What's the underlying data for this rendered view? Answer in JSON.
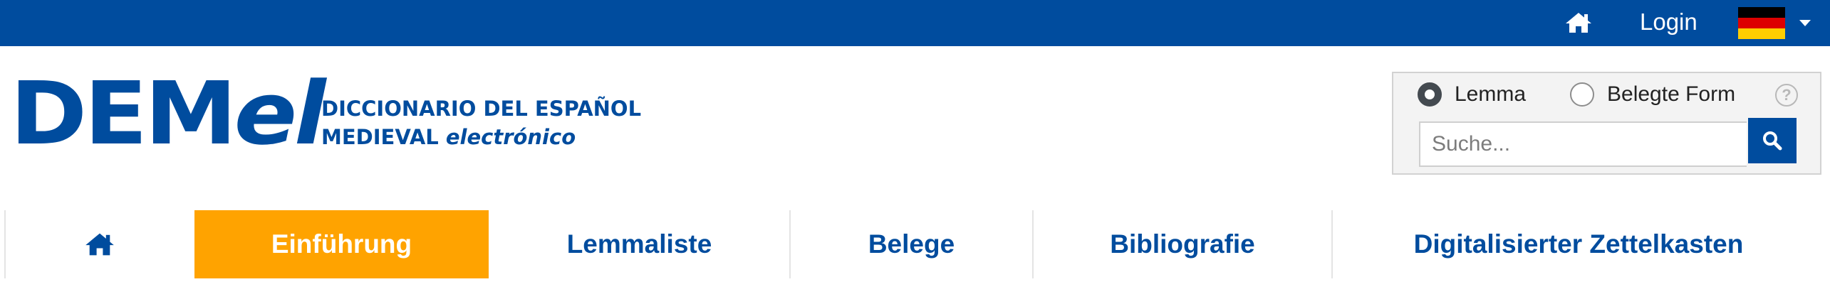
{
  "topbar": {
    "home_icon": "home-icon",
    "login_label": "Login",
    "language_flag": "german-flag-icon",
    "flag_colors": [
      "#000000",
      "#dd0000",
      "#ffce00"
    ],
    "background": "#004c9e"
  },
  "branding": {
    "logo_main": "DEM",
    "logo_italic": "el",
    "subtitle_line1": "DICCIONARIO DEL ESPAÑOL",
    "subtitle_line2_plain": "MEDIEVAL",
    "subtitle_line2_italic": "electrónico",
    "brand_color": "#004c9e"
  },
  "search": {
    "options": [
      {
        "label": "Lemma",
        "checked": true
      },
      {
        "label": "Belegte Form",
        "checked": false
      }
    ],
    "help_symbol": "?",
    "placeholder": "Suche...",
    "value": "",
    "button_icon": "search-icon"
  },
  "nav": {
    "home_icon": "home-icon",
    "items": [
      {
        "label": "Einführung",
        "active": true
      },
      {
        "label": "Lemmaliste",
        "active": false
      },
      {
        "label": "Belege",
        "active": false
      },
      {
        "label": "Bibliografie",
        "active": false
      },
      {
        "label": "Digitalisierter Zettelkasten",
        "active": false
      }
    ],
    "active_color": "#ffa300"
  }
}
